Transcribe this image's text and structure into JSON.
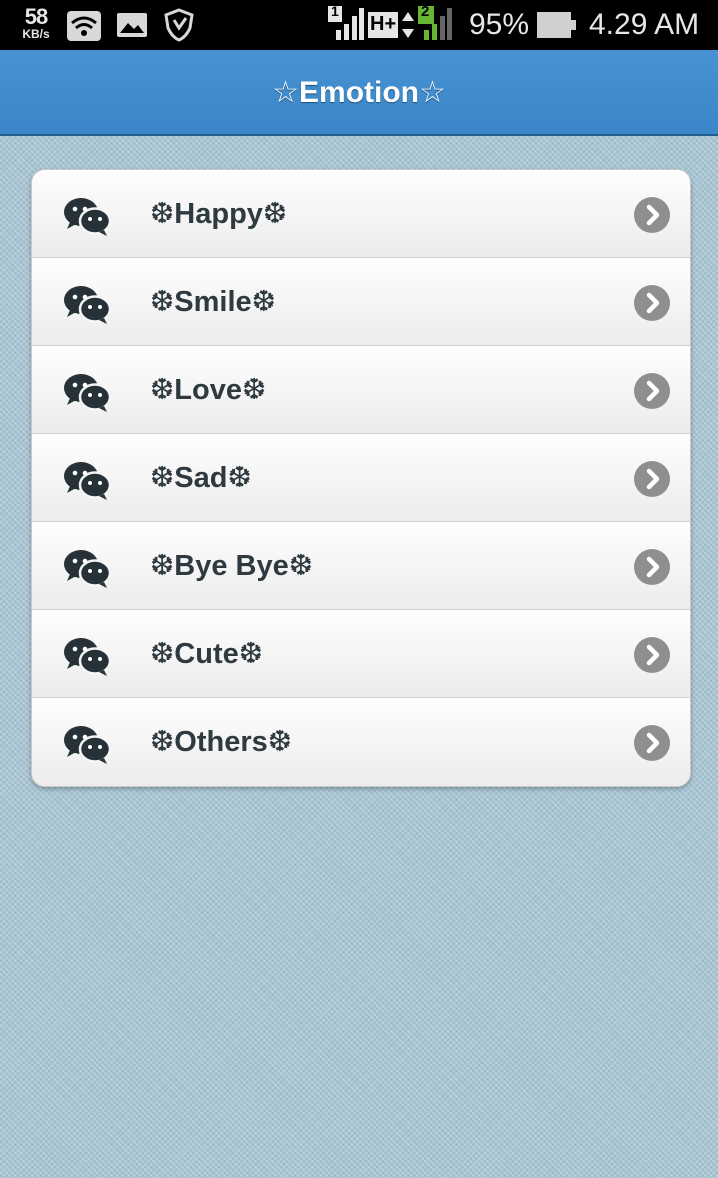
{
  "status_bar": {
    "net_speed_value": "58",
    "net_speed_unit": "KB/s",
    "sim1_label": "1",
    "network_type": "H+",
    "sim2_label": "2",
    "battery_percent": "95%",
    "time": "4.29 AM",
    "icons": [
      "wifi-icon",
      "image-notification-icon",
      "shield-notification-icon",
      "signal-icon",
      "battery-icon"
    ]
  },
  "header": {
    "title": "☆Emotion☆"
  },
  "list": {
    "items": [
      {
        "label": "❆Happy❆",
        "icon": "wechat-icon"
      },
      {
        "label": "❆Smile❆",
        "icon": "wechat-icon"
      },
      {
        "label": "❆Love❆",
        "icon": "wechat-icon"
      },
      {
        "label": "❆Sad❆",
        "icon": "wechat-icon"
      },
      {
        "label": "❆Bye Bye❆",
        "icon": "wechat-icon"
      },
      {
        "label": "❆Cute❆",
        "icon": "wechat-icon"
      },
      {
        "label": "❆Others❆",
        "icon": "wechat-icon"
      }
    ]
  },
  "colors": {
    "header": "#4190d0",
    "background": "#a9c5d4",
    "item_text": "#2e3a3f",
    "chevron": "#8f8f8f"
  }
}
